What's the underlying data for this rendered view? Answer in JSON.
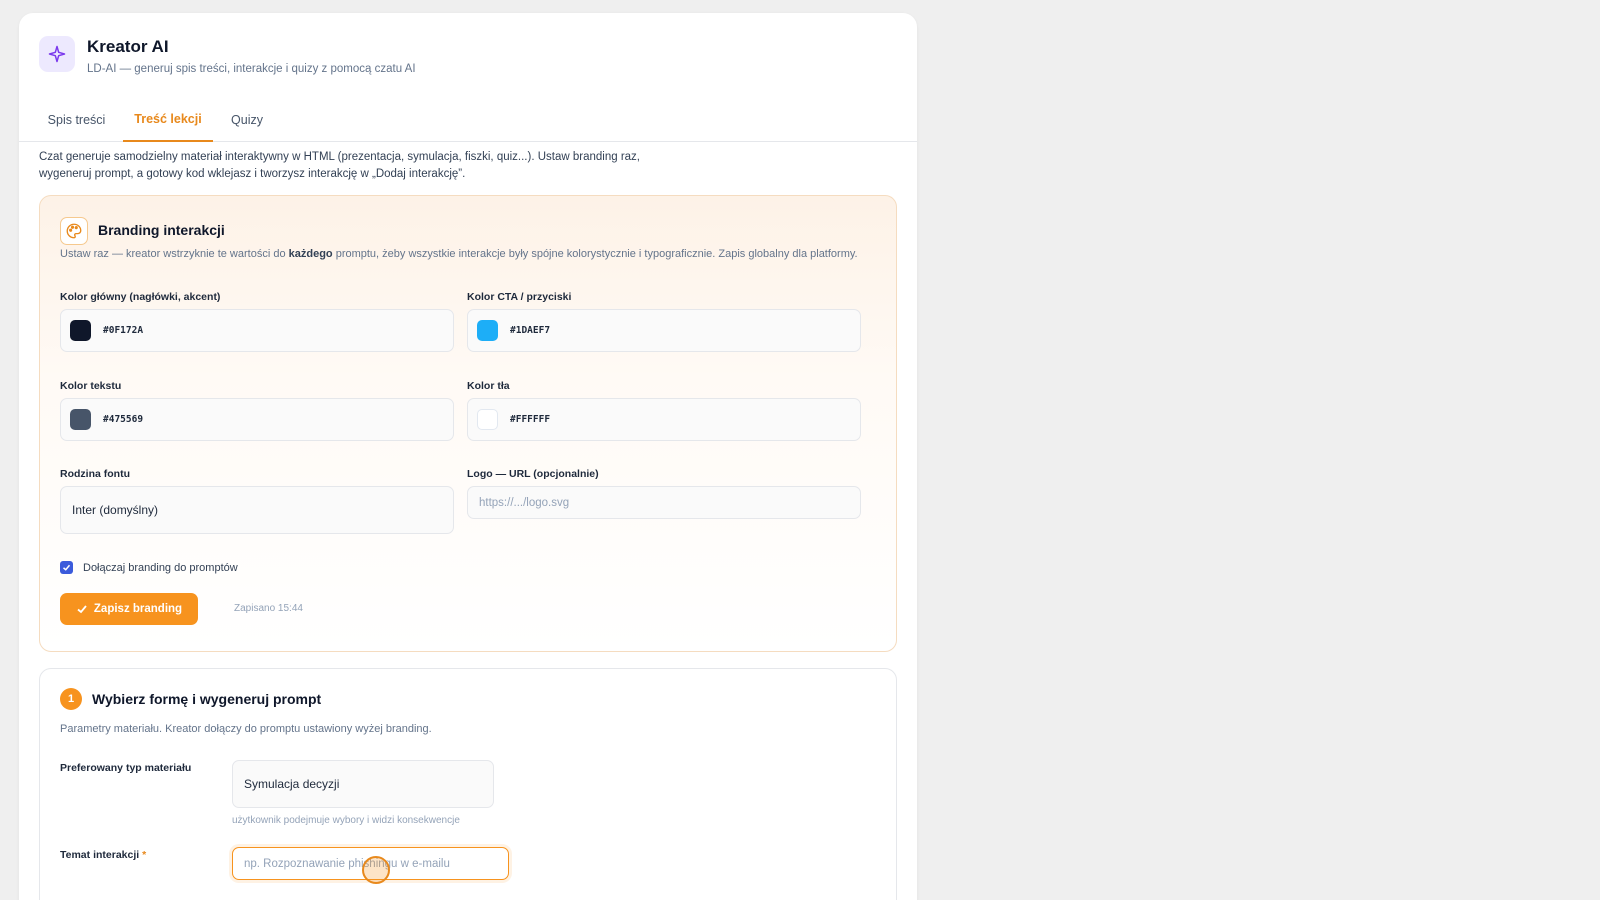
{
  "header": {
    "title": "Kreator AI",
    "subtitle": "LD-AI — generuj spis treści, interakcje i quizy z pomocą czatu AI"
  },
  "tabs": [
    {
      "label": "Spis treści",
      "active": false
    },
    {
      "label": "Treść lekcji",
      "active": true
    },
    {
      "label": "Quizy",
      "active": false
    }
  ],
  "intro": "Czat generuje samodzielny materiał interaktywny w HTML (prezentacja, symulacja, fiszki, quiz...). Ustaw branding raz, wygeneruj prompt, a gotowy kod wklejasz i tworzysz interakcję w „Dodaj interakcję”.",
  "branding": {
    "title": "Branding interakcji",
    "desc_pre": "Ustaw raz — kreator wstrzyknie te wartości do ",
    "desc_bold": "każdego",
    "desc_post": " promptu, żeby wszystkie interakcje były spójne kolorystycznie i typograficznie. Zapis globalny dla platformy.",
    "primary_label": "Kolor główny (nagłówki, akcent)",
    "primary_value": "#0F172A",
    "cta_label": "Kolor CTA / przyciski",
    "cta_value": "#1DAEF7",
    "text_label": "Kolor tekstu",
    "text_value": "#475569",
    "bg_label": "Kolor tła",
    "bg_value": "#FFFFFF",
    "font_label": "Rodzina fontu",
    "font_value": "Inter (domyślny)",
    "logo_label": "Logo — URL (opcjonalnie)",
    "logo_placeholder": "https://.../logo.svg",
    "checkbox_label": "Dołączaj branding do promptów",
    "checkbox_checked": true,
    "save_label": "Zapisz branding",
    "saved_text": "Zapisano 15:44"
  },
  "step1": {
    "number": "1",
    "title": "Wybierz formę i wygeneruj prompt",
    "desc": "Parametry materiału. Kreator dołączy do promptu ustawiony wyżej branding.",
    "type_label": "Preferowany typ materiału",
    "type_value": "Symulacja decyzji",
    "type_hint": "użytkownik podejmuje wybory i widzi konsekwencje",
    "topic_label": "Temat interakcji",
    "topic_required": "*",
    "topic_placeholder": "np. Rozpoznawanie phishingu w e-mailu"
  },
  "colors": {
    "accent": "#f7931e",
    "app_icon": "#7c3aed"
  },
  "icons": {
    "app": "sparkle-icon",
    "branding": "palette-icon",
    "save": "check-icon"
  }
}
